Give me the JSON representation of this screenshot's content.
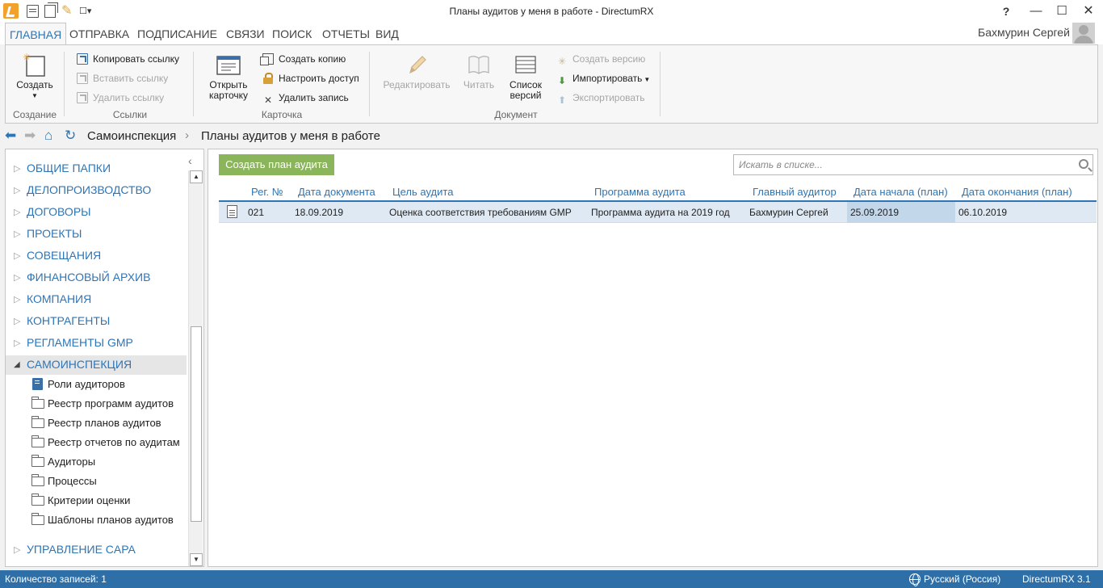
{
  "window": {
    "title": "Планы аудитов у меня в работе - DirectumRX",
    "help": "?",
    "minimize": "—",
    "maximize": "☐",
    "close": "✕"
  },
  "ribbon_tabs": [
    "ГЛАВНАЯ",
    "ОТПРАВКА",
    "ПОДПИСАНИЕ",
    "СВЯЗИ",
    "ПОИСК",
    "ОТЧЕТЫ",
    "ВИД"
  ],
  "user": {
    "name": "Бахмурин Сергей"
  },
  "ribbon": {
    "create": {
      "label": "Создать",
      "group": "Создание"
    },
    "links": {
      "copy": "Копировать ссылку",
      "paste": "Вставить ссылку",
      "delete": "Удалить ссылку",
      "group": "Ссылки"
    },
    "card": {
      "open": "Открыть карточку",
      "copy": "Создать копию",
      "access": "Настроить доступ",
      "delete": "Удалить запись",
      "group": "Карточка"
    },
    "document": {
      "edit": "Редактировать",
      "read": "Читать",
      "versions": "Список версий",
      "create_version": "Создать версию",
      "import": "Импортировать",
      "export": "Экспортировать",
      "group": "Документ"
    }
  },
  "breadcrumb": [
    "Самоинспекция",
    "Планы аудитов у меня в работе"
  ],
  "nav": {
    "items": [
      "ОБЩИЕ ПАПКИ",
      "ДЕЛОПРОИЗВОДСТВО",
      "ДОГОВОРЫ",
      "ПРОЕКТЫ",
      "СОВЕЩАНИЯ",
      "ФИНАНСОВЫЙ АРХИВ",
      "КОМПАНИЯ",
      "КОНТРАГЕНТЫ",
      "РЕГЛАМЕНТЫ GMP",
      "САМОИНСПЕКЦИЯ"
    ],
    "selected": "САМОИНСПЕКЦИЯ",
    "sub_items": [
      "Роли аудиторов",
      "Реестр программ аудитов",
      "Реестр планов аудитов",
      "Реестр отчетов по аудитам",
      "Аудиторы",
      "Процессы",
      "Критерии оценки",
      "Шаблоны планов аудитов"
    ],
    "last_item": "УПРАВЛЕНИЕ CAPA"
  },
  "main": {
    "create_button": "Создать план аудита",
    "search_placeholder": "Искать в списке...",
    "columns": [
      "Рег. №",
      "Дата документа",
      "Цель аудита",
      "Программа аудита",
      "Главный аудитор",
      "Дата начала (план)",
      "Дата окончания (план)"
    ],
    "rows": [
      {
        "reg_no": "021",
        "doc_date": "18.09.2019",
        "goal": "Оценка соответствия требованиям GMP",
        "program": "Программа аудита на 2019 год",
        "auditor": "Бахмурин Сергей",
        "start": "25.09.2019",
        "end": "06.10.2019"
      }
    ]
  },
  "status_bar": {
    "count": "Количество записей: 1",
    "language": "Русский (Россия)",
    "version": "DirectumRX 3.1"
  },
  "colors": {
    "accent": "#2e75b5",
    "status_bar": "#2e6fa7",
    "create_button": "#8bb55a",
    "row_selected": "#dfe9f3"
  }
}
